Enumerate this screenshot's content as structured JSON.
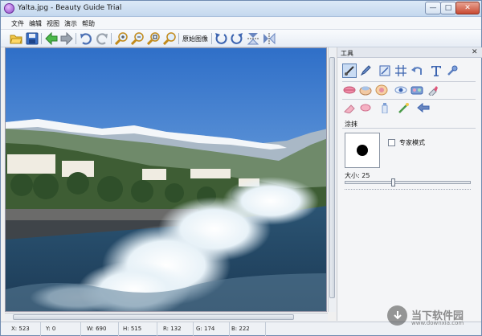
{
  "window": {
    "title": "Yalta.jpg - Beauty Guide Trial"
  },
  "menu": [
    "文件",
    "编辑",
    "视图",
    "演示",
    "帮助"
  ],
  "toolbar": {
    "items": [
      "open-icon",
      "save-icon",
      "back-arrow-icon",
      "forward-arrow-icon",
      "undo-icon",
      "redo-icon",
      "zoom-in-icon",
      "zoom-out-icon",
      "zoom-fit-icon",
      "zoom-actual-icon",
      "rotate-left-icon",
      "rotate-right-icon",
      "flip-vertical-icon",
      "flip-horizontal-icon"
    ],
    "original_label": "原始图像"
  },
  "tools_panel": {
    "title": "工具",
    "close": "✕",
    "section_label": "涂抹",
    "expert_mode_label": "专家模式",
    "expert_mode_checked": false,
    "size_label": "大小: 25",
    "size_value": 25,
    "row1": [
      "brush-icon",
      "pencil-icon",
      "resize-icon",
      "crop-grid-icon",
      "undo-arrow-icon",
      "text-icon",
      "eyedropper-icon"
    ],
    "row2": [
      "lips-icon",
      "foundation-icon",
      "blush-icon",
      "eye-icon",
      "eyeshadow-icon",
      "lipstick-icon"
    ],
    "row3": [
      "eraser-icon",
      "smudge-icon",
      "bottle-icon",
      "wand-icon",
      "arrow-in-icon"
    ]
  },
  "status": {
    "x": "X: 523",
    "y": "Y: 0",
    "w": "W: 690",
    "h": "H: 515",
    "r": "R: 132",
    "g": "G: 174",
    "b": "B: 222"
  },
  "watermark": {
    "text": "当下软件园",
    "sub": "www.downxia.com"
  },
  "colors": {
    "sky": "#84aede",
    "sea": "#244a68",
    "accent": "#5a7eb3"
  }
}
